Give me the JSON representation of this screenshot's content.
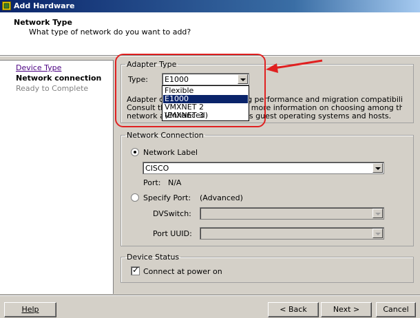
{
  "window": {
    "title": "Add Hardware"
  },
  "header": {
    "title": "Network Type",
    "subtitle": "What type of network do you want to add?"
  },
  "steps": [
    {
      "label": "Device Type",
      "state": "completed-link"
    },
    {
      "label": "Network connection",
      "state": "current"
    },
    {
      "label": "Ready to Complete",
      "state": "pending"
    }
  ],
  "adapter": {
    "group_label": "Adapter Type",
    "type_label": "Type:",
    "selected": "E1000",
    "options": [
      "Flexible",
      "E1000",
      "VMXNET 2 (Enhanced)",
      "VMXNET 3"
    ],
    "highlighted_option": "E1000",
    "description_line1_left": "Adapter ch",
    "description_line1_right": "rking performance and migration compatibility.",
    "description_line2_left": "Consult the",
    "description_line2_right": "or more information on choosing among the",
    "description_line3_left": "network ad",
    "description_line3_right": "s guest operating systems and hosts."
  },
  "network_connection": {
    "group_label": "Network Connection",
    "network_label_option": "Network Label",
    "network_label_value": "CISCO",
    "port_label": "Port:",
    "port_value": "N/A",
    "specify_port_option": "Specify Port:",
    "advanced_note": "(Advanced)",
    "dvswitch_label": "DVSwitch:",
    "port_uuid_label": "Port UUID:",
    "selected_option": "Network Label"
  },
  "device_status": {
    "group_label": "Device Status",
    "connect_label": "Connect at power on",
    "connect_checked": true
  },
  "buttons": {
    "help": "Help",
    "back": "< Back",
    "next": "Next >",
    "cancel": "Cancel"
  },
  "annotation": {
    "color": "#e02020"
  }
}
